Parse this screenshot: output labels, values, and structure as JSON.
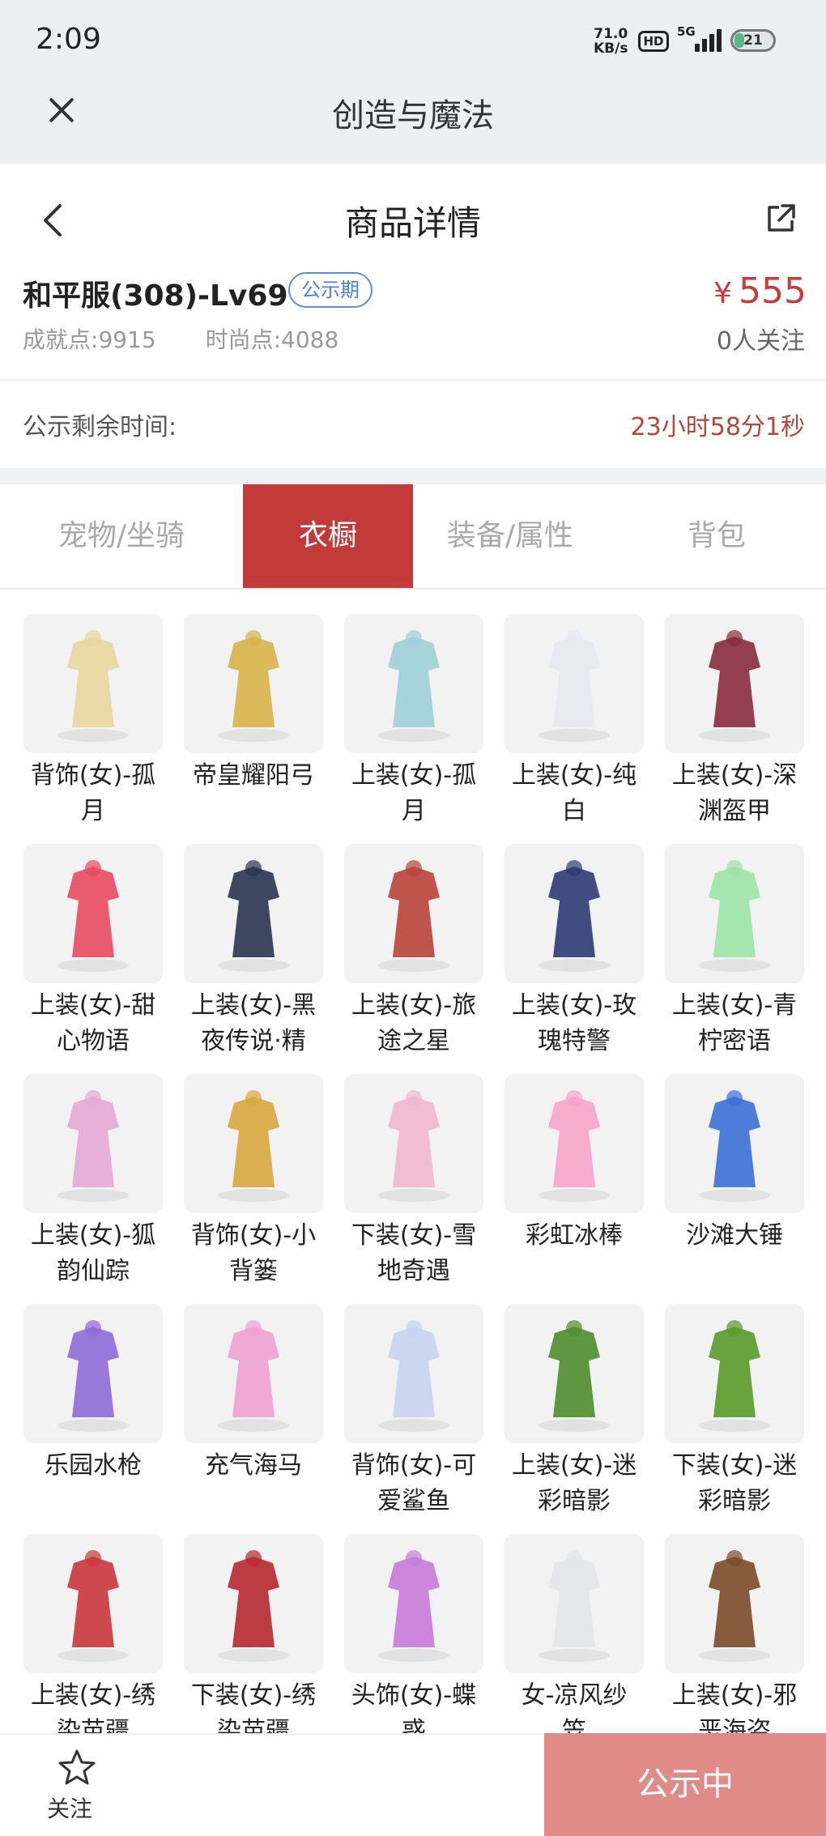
{
  "status": {
    "time": "2:09",
    "speed_value": "71.0",
    "speed_unit": "KB/s",
    "hd": "HD",
    "net": "5G",
    "battery": "21"
  },
  "app": {
    "title": "创造与魔法"
  },
  "page": {
    "title": "商品详情"
  },
  "product": {
    "name": "和平服(308)-Lv69",
    "badge": "公示期",
    "price_symbol": "¥",
    "price": "555",
    "achievement_label": "成就点:",
    "achievement_value": "9915",
    "fashion_label": "时尚点:",
    "fashion_value": "4088",
    "follow_count": "0人关注"
  },
  "timer": {
    "label": "公示剩余时间:",
    "value": "23小时58分1秒"
  },
  "tabs": [
    {
      "label": "宠物/坐骑"
    },
    {
      "label": "衣橱"
    },
    {
      "label": "装备/属性"
    },
    {
      "label": "背包"
    }
  ],
  "items": [
    {
      "line1": "背饰(女)-孤",
      "line2": "月",
      "icon": "ribbon-icon"
    },
    {
      "line1": "帝皇耀阳弓",
      "line2": "",
      "icon": "bow-icon"
    },
    {
      "line1": "上装(女)-孤",
      "line2": "月",
      "icon": "dress-icon"
    },
    {
      "line1": "上装(女)-纯",
      "line2": "白",
      "icon": "wedding-dress-icon"
    },
    {
      "line1": "上装(女)-深",
      "line2": "渊盔甲",
      "icon": "armor-icon"
    },
    {
      "line1": "上装(女)-甜",
      "line2": "心物语",
      "icon": "dress-icon"
    },
    {
      "line1": "上装(女)-黑",
      "line2": "夜传说·精",
      "icon": "coat-icon"
    },
    {
      "line1": "上装(女)-旅",
      "line2": "途之星",
      "icon": "dress-icon"
    },
    {
      "line1": "上装(女)-玫",
      "line2": "瑰特警",
      "icon": "uniform-icon"
    },
    {
      "line1": "上装(女)-青",
      "line2": "柠密语",
      "icon": "dress-icon"
    },
    {
      "line1": "上装(女)-狐",
      "line2": "韵仙踪",
      "icon": "dress-icon"
    },
    {
      "line1": "背饰(女)-小",
      "line2": "背篓",
      "icon": "basket-icon"
    },
    {
      "line1": "下装(女)-雪",
      "line2": "地奇遇",
      "icon": "boots-icon"
    },
    {
      "line1": "彩虹冰棒",
      "line2": "",
      "icon": "popsicle-icon"
    },
    {
      "line1": "沙滩大锤",
      "line2": "",
      "icon": "hammer-icon"
    },
    {
      "line1": "乐园水枪",
      "line2": "",
      "icon": "water-gun-icon"
    },
    {
      "line1": "充气海马",
      "line2": "",
      "icon": "bow-icon"
    },
    {
      "line1": "背饰(女)-可",
      "line2": "爱鲨鱼",
      "icon": "shark-icon"
    },
    {
      "line1": "上装(女)-迷",
      "line2": "彩暗影",
      "icon": "ghillie-icon"
    },
    {
      "line1": "下装(女)-迷",
      "line2": "彩暗影",
      "icon": "ghillie-pants-icon"
    },
    {
      "line1": "上装(女)-绣",
      "line2": "染苗疆",
      "icon": "poncho-icon"
    },
    {
      "line1": "下装(女)-绣",
      "line2": "染苗疆",
      "icon": "skirt-icon"
    },
    {
      "line1": "头饰(女)-蝶",
      "line2": "惑",
      "icon": "head-icon"
    },
    {
      "line1": "女-凉风纱",
      "line2": "笠",
      "icon": "veil-hat-icon"
    },
    {
      "line1": "上装(女)-邪",
      "line2": "恶海盗",
      "icon": "coat-icon"
    }
  ],
  "bottom": {
    "follow_label": "关注",
    "cta_label": "公示中"
  },
  "colors": {
    "accent": "#c23a3a",
    "price": "#c83c3c",
    "badge": "#4a84d0",
    "cta": "#e08b88"
  }
}
